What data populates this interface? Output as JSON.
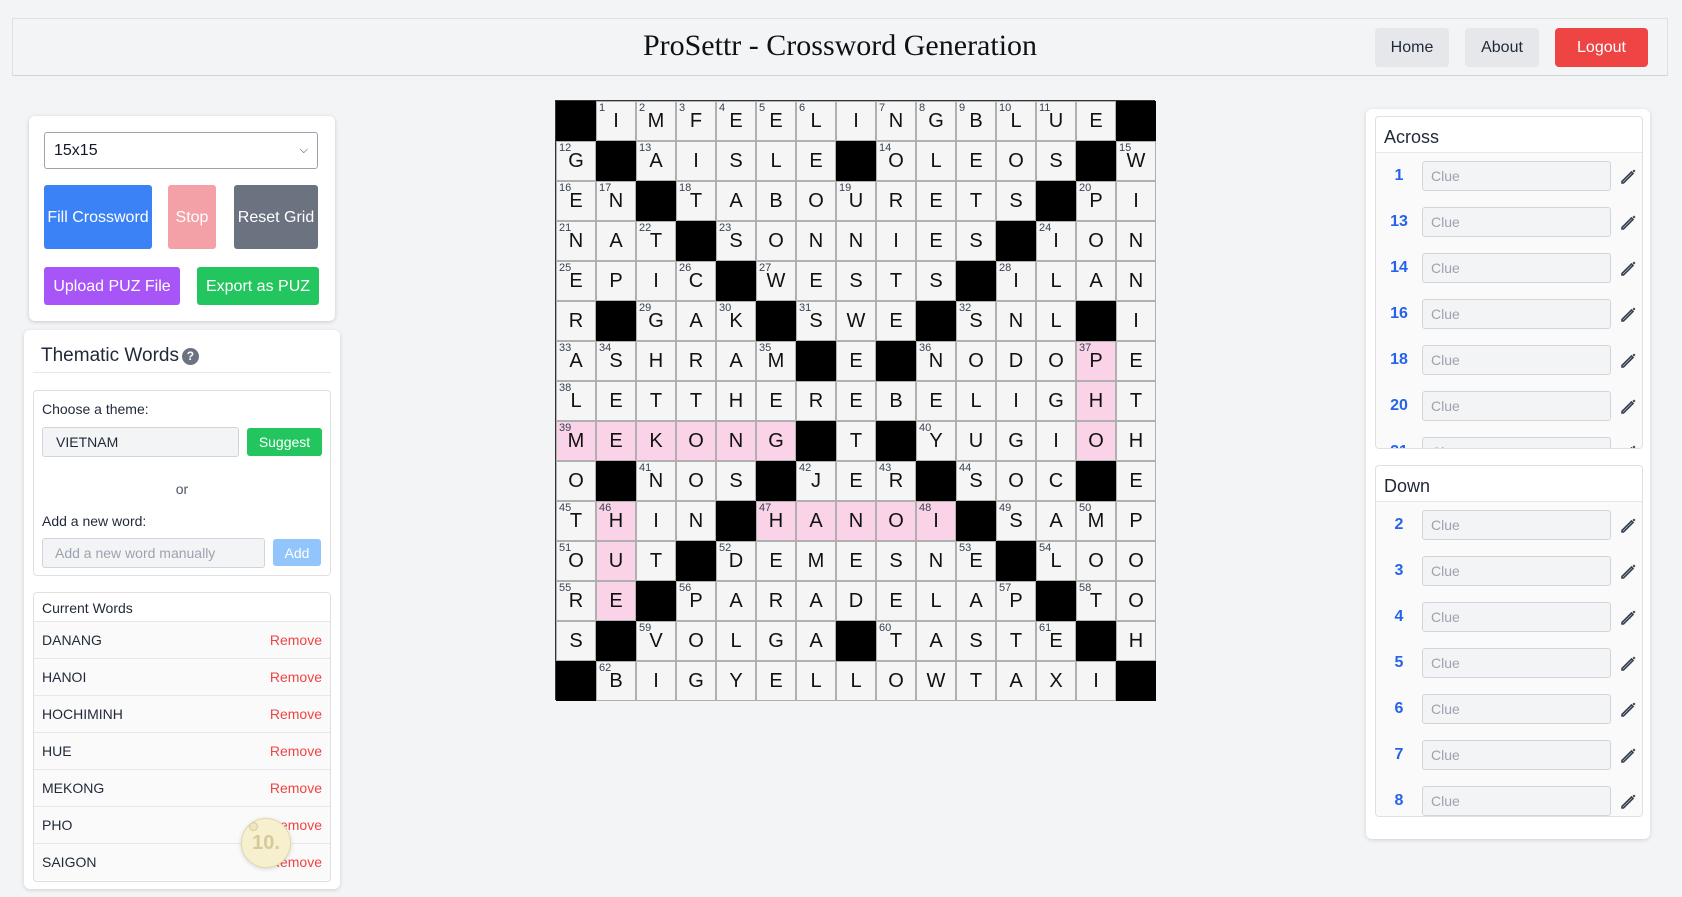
{
  "header": {
    "title": "ProSettr - Crossword Generation",
    "nav": {
      "home": "Home",
      "about": "About",
      "logout": "Logout"
    }
  },
  "controls": {
    "size_value": "15x15",
    "fill_label": "Fill Crossword",
    "stop_label": "Stop",
    "reset_label": "Reset Grid",
    "upload_label": "Upload PUZ File",
    "export_label": "Export as PUZ"
  },
  "thematic": {
    "title": "Thematic Words",
    "help_glyph": "?",
    "choose_label": "Choose a theme:",
    "theme_value": "VIETNAM",
    "suggest_label": "Suggest",
    "or_text": "or",
    "add_label": "Add a new word:",
    "add_placeholder": "Add a new word manually",
    "add_button": "Add",
    "current_title": "Current Words",
    "remove_label": "Remove",
    "words": [
      "DANANG",
      "HANOI",
      "HOCHIMINH",
      "HUE",
      "MEKONG",
      "PHO",
      "SAIGON"
    ]
  },
  "grid": {
    "size": 15,
    "rows": [
      "#IMFEELINGBLUE#",
      "G#AISLE#OLEOS#W",
      "EN#TABOURETS#PI",
      "NAT#SONNIES#ION",
      "EPIC#WESTS#ILAN",
      "R#GAK#SWE#SNL#I",
      "ASHRAM#E#NODOPE",
      "LETTHEREBELIGHT",
      "MEKONG#T#YUGIOH",
      "O#NOS#JER#SOC#E",
      "THIN#HANOI#SAMP",
      "OUT#DEMESNE#LOO",
      "RE#PARADELAP#TO",
      "S#VOLGA#TASTE#H",
      "#BIGYELLOWTAXI#"
    ],
    "numbers": {
      "0,1": "1",
      "0,2": "2",
      "0,3": "3",
      "0,4": "4",
      "0,5": "5",
      "0,6": "6",
      "0,8": "7",
      "0,9": "8",
      "0,10": "9",
      "0,11": "10",
      "0,12": "11",
      "1,0": "12",
      "1,2": "13",
      "1,8": "14",
      "1,14": "15",
      "2,0": "16",
      "2,1": "17",
      "2,3": "18",
      "2,7": "19",
      "2,13": "20",
      "3,0": "21",
      "3,2": "22",
      "3,4": "23",
      "3,12": "24",
      "4,0": "25",
      "4,3": "26",
      "4,5": "27",
      "4,11": "28",
      "5,2": "29",
      "5,4": "30",
      "5,6": "31",
      "5,10": "32",
      "6,0": "33",
      "6,1": "34",
      "6,5": "35",
      "6,9": "36",
      "6,13": "37",
      "7,0": "38",
      "8,0": "39",
      "8,9": "40",
      "9,2": "41",
      "9,6": "42",
      "9,8": "43",
      "9,10": "44",
      "10,0": "45",
      "10,1": "46",
      "10,5": "47",
      "10,9": "48",
      "10,11": "49",
      "10,13": "50",
      "11,0": "51",
      "11,4": "52",
      "11,10": "53",
      "11,12": "54",
      "12,0": "55",
      "12,3": "56",
      "12,11": "57",
      "12,13": "58",
      "13,2": "59",
      "13,8": "60",
      "13,12": "61",
      "14,1": "62"
    },
    "theme_cells": [
      "6,13",
      "7,13",
      "8,13",
      "8,0",
      "8,1",
      "8,2",
      "8,3",
      "8,4",
      "8,5",
      "10,1",
      "11,1",
      "12,1",
      "10,5",
      "10,6",
      "10,7",
      "10,8",
      "10,9"
    ],
    "colors": {
      "theme": "#fbd3e9",
      "block": "#000000",
      "cell": "#f5f5f5"
    }
  },
  "clues": {
    "across_title": "Across",
    "down_title": "Down",
    "placeholder": "Clue",
    "across": [
      "1",
      "13",
      "14",
      "16",
      "18",
      "20",
      "21"
    ],
    "down": [
      "2",
      "3",
      "4",
      "5",
      "6",
      "7",
      "8"
    ]
  }
}
